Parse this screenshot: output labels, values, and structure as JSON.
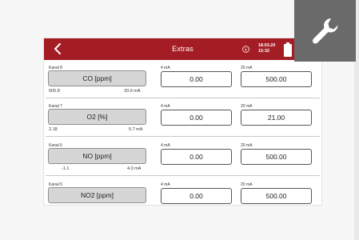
{
  "header": {
    "title": "Extras",
    "date": "18.03.20",
    "time": "15:32"
  },
  "channels": [
    {
      "kanal": "Kanal 8",
      "name": "CO [ppm]",
      "raw_value": "505.8",
      "raw_ma": "20.0  mA",
      "label_4ma": "4 mA",
      "value_4ma": "0.00",
      "label_20ma": "20 mA",
      "value_20ma": "500.00"
    },
    {
      "kanal": "Kanal 7",
      "name": "O2 [%]",
      "raw_value": "2.18",
      "raw_ma": "5.7  mA",
      "label_4ma": "4 mA",
      "value_4ma": "0.00",
      "label_20ma": "20 mA",
      "value_20ma": "21.00"
    },
    {
      "kanal": "Kanal 6",
      "name": "NO [ppm]",
      "raw_value": "-1.1",
      "raw_ma": "4.0  mA",
      "label_4ma": "4 mA",
      "value_4ma": "0.00",
      "label_20ma": "20 mA",
      "value_20ma": "500.00"
    },
    {
      "kanal": "Kanal 5",
      "name": "NO2 [ppm]",
      "raw_value": "",
      "raw_ma": "",
      "label_4ma": "4 mA",
      "value_4ma": "0.00",
      "label_20ma": "20 mA",
      "value_20ma": "500.00"
    }
  ],
  "colors": {
    "header": "#a51d24",
    "wrench_tile": "#6a6a6a"
  },
  "icons": {
    "back": "chevron-left-icon",
    "info": "info-icon",
    "battery": "battery-icon",
    "wrench": "wrench-icon"
  }
}
